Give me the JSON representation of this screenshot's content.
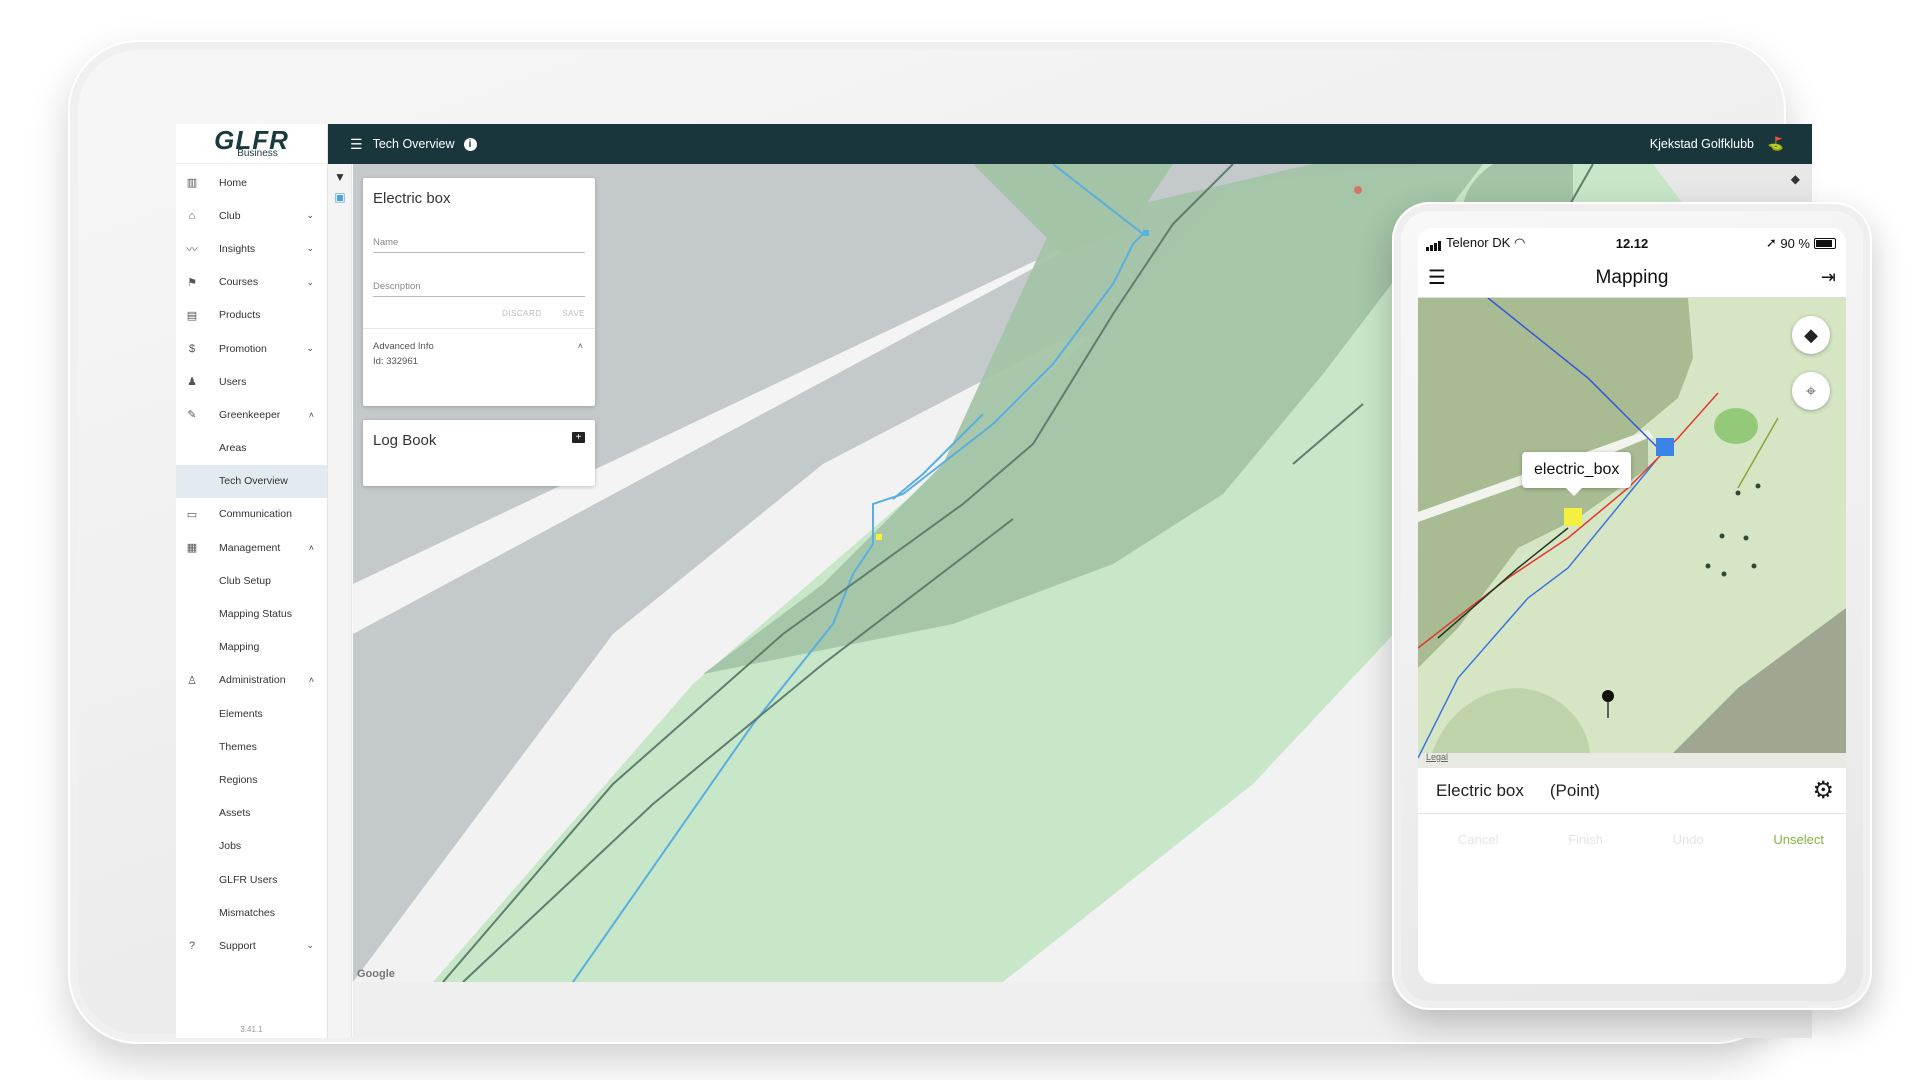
{
  "brand": {
    "name": "GLFR",
    "sub": "Business"
  },
  "topbar": {
    "title": "Tech Overview",
    "club": "Kjekstad Golfklubb"
  },
  "sidebar": {
    "items": [
      {
        "label": "Home",
        "icon": "home-icon",
        "sub": false,
        "chevron": ""
      },
      {
        "label": "Club",
        "icon": "club-icon",
        "sub": false,
        "chevron": "⌄"
      },
      {
        "label": "Insights",
        "icon": "insights-icon",
        "sub": false,
        "chevron": "⌄"
      },
      {
        "label": "Courses",
        "icon": "courses-icon",
        "sub": false,
        "chevron": "⌄"
      },
      {
        "label": "Products",
        "icon": "products-icon",
        "sub": false,
        "chevron": ""
      },
      {
        "label": "Promotion",
        "icon": "promotion-icon",
        "sub": false,
        "chevron": "⌄"
      },
      {
        "label": "Users",
        "icon": "users-icon",
        "sub": false,
        "chevron": ""
      },
      {
        "label": "Greenkeeper",
        "icon": "wrench-icon",
        "sub": false,
        "chevron": "˄"
      },
      {
        "label": "Areas",
        "icon": "",
        "sub": true,
        "chevron": ""
      },
      {
        "label": "Tech Overview",
        "icon": "",
        "sub": true,
        "chevron": "",
        "active": true
      },
      {
        "label": "Communication",
        "icon": "communication-icon",
        "sub": false,
        "chevron": ""
      },
      {
        "label": "Management",
        "icon": "management-icon",
        "sub": false,
        "chevron": "˄"
      },
      {
        "label": "Club Setup",
        "icon": "",
        "sub": true,
        "chevron": ""
      },
      {
        "label": "Mapping Status",
        "icon": "",
        "sub": true,
        "chevron": ""
      },
      {
        "label": "Mapping",
        "icon": "",
        "sub": true,
        "chevron": ""
      },
      {
        "label": "Administration",
        "icon": "administration-icon",
        "sub": false,
        "chevron": "˄"
      },
      {
        "label": "Elements",
        "icon": "",
        "sub": true,
        "chevron": ""
      },
      {
        "label": "Themes",
        "icon": "",
        "sub": true,
        "chevron": ""
      },
      {
        "label": "Regions",
        "icon": "",
        "sub": true,
        "chevron": ""
      },
      {
        "label": "Assets",
        "icon": "",
        "sub": true,
        "chevron": ""
      },
      {
        "label": "Jobs",
        "icon": "",
        "sub": true,
        "chevron": ""
      },
      {
        "label": "GLFR Users",
        "icon": "",
        "sub": true,
        "chevron": ""
      },
      {
        "label": "Mismatches",
        "icon": "",
        "sub": true,
        "chevron": ""
      },
      {
        "label": "Support",
        "icon": "support-icon",
        "sub": false,
        "chevron": "⌄"
      }
    ],
    "version": "3.41.1"
  },
  "element_panel": {
    "title": "Electric box",
    "name_placeholder": "Name",
    "description_placeholder": "Description",
    "discard": "DISCARD",
    "save": "SAVE",
    "advanced_label": "Advanced Info",
    "id_text": "Id: 332961"
  },
  "logbook": {
    "title": "Log Book"
  },
  "map": {
    "attribution": "Google"
  },
  "phone": {
    "carrier": "Telenor DK",
    "time": "12.12",
    "battery": "90 %",
    "title": "Mapping",
    "callout": "electric_box",
    "legal": "Legal",
    "element_name": "Electric box",
    "element_type": "(Point)",
    "actions": {
      "cancel": "Cancel",
      "finish": "Finish",
      "undo": "Undo",
      "unselect": "Unselect"
    }
  },
  "colors": {
    "topbar": "#18363c",
    "fairway": "#c8e6c8",
    "rough": "#9fbf9f",
    "water_line": "#5aaee0",
    "cable_line": "#5e7e6e",
    "electric_box": "#f4f040",
    "accent_green": "#7fb53d"
  }
}
